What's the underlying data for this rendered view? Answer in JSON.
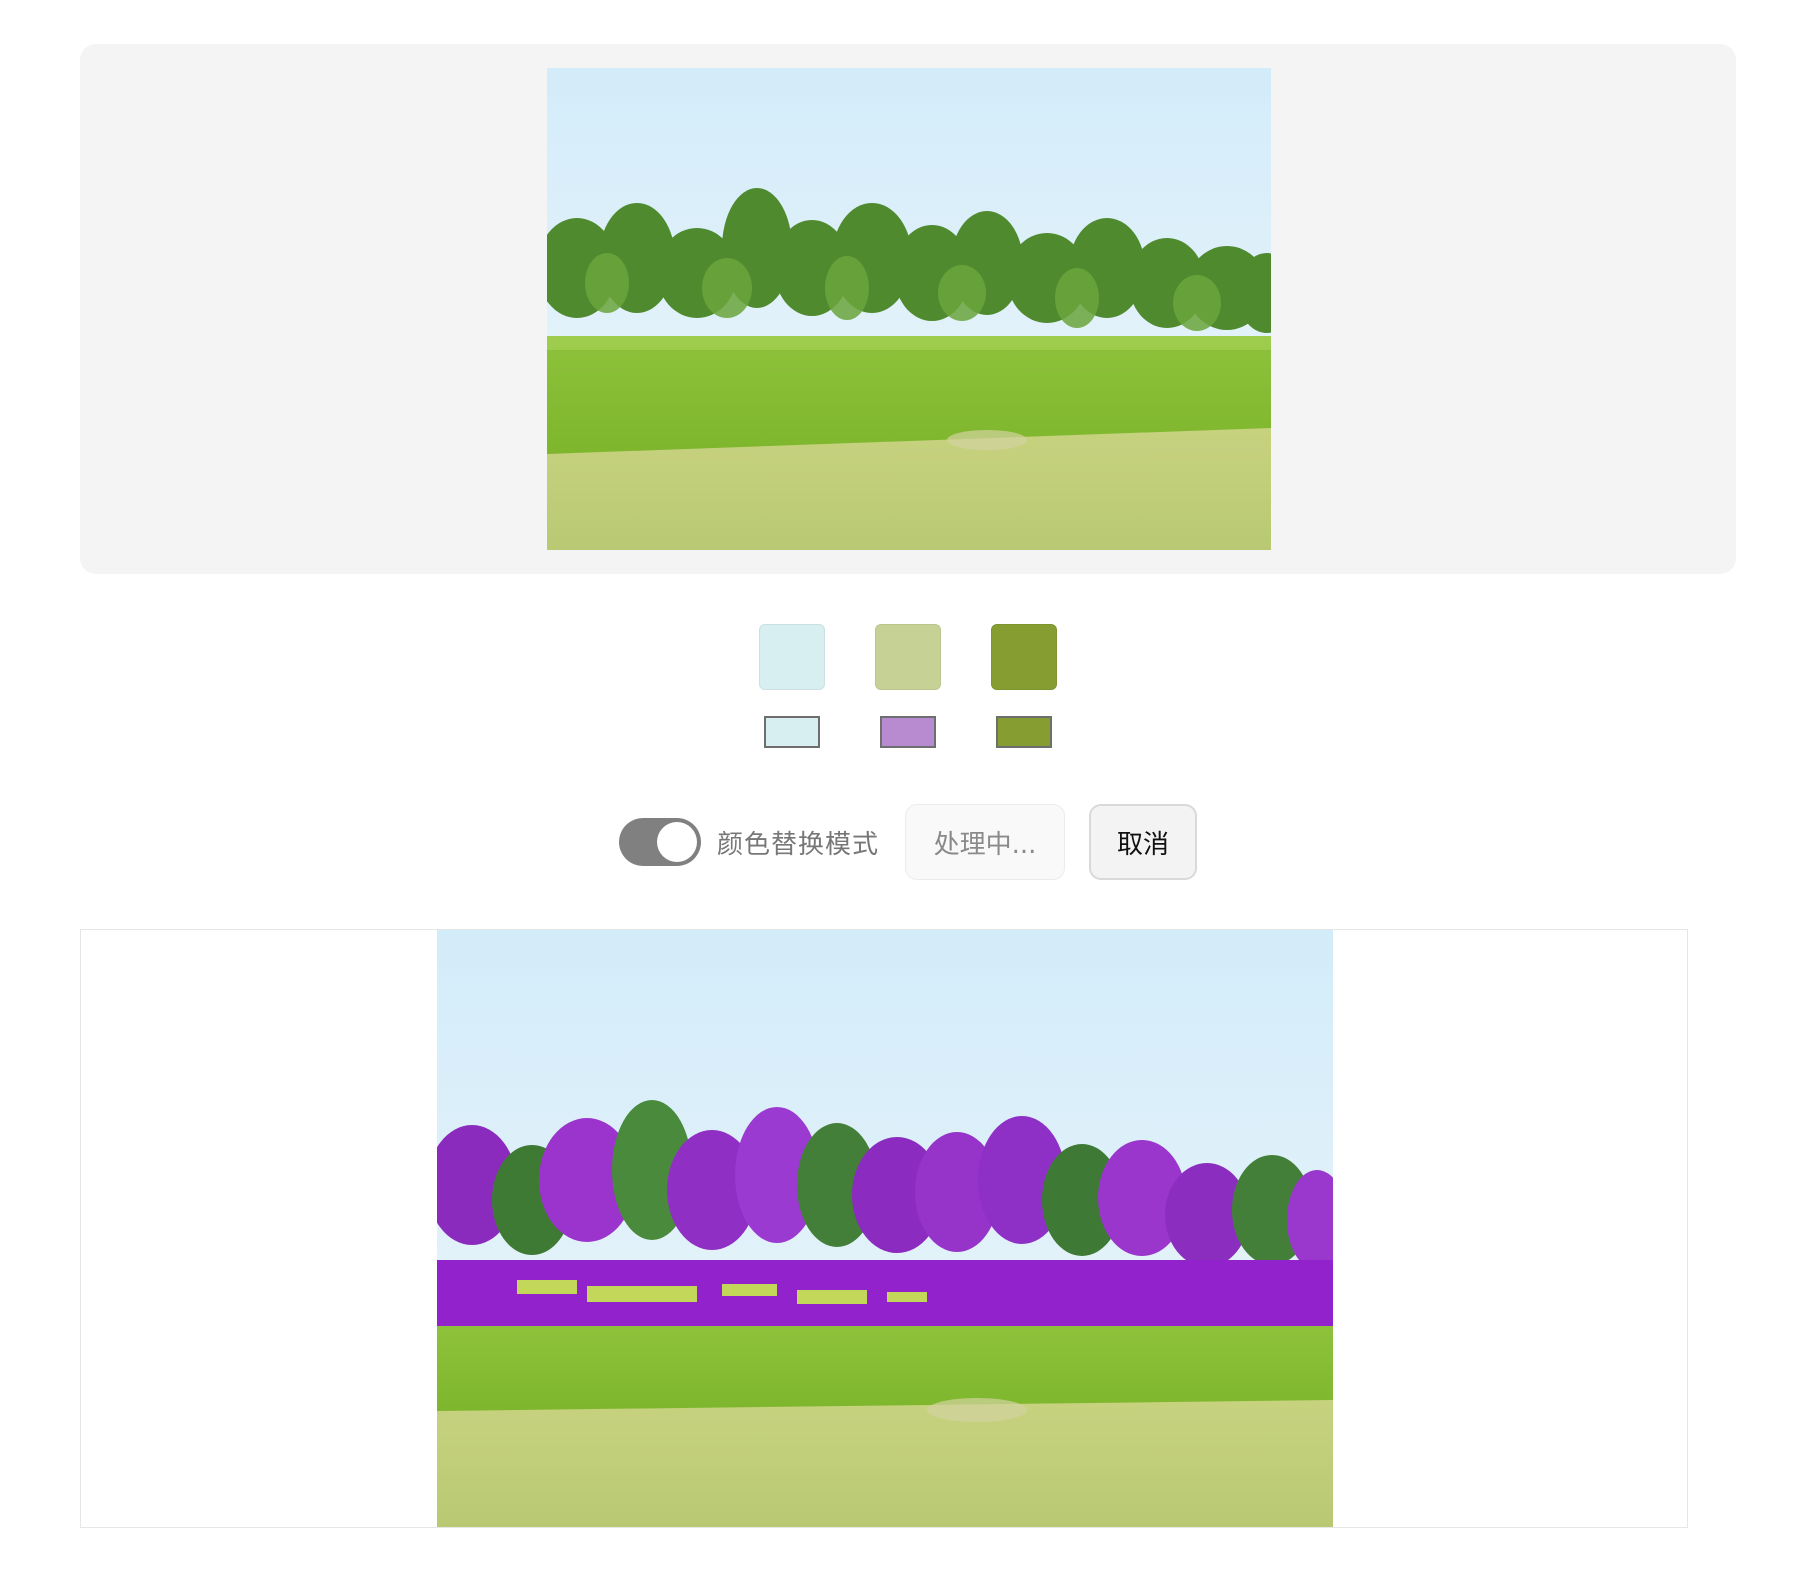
{
  "source_image": {
    "alt": "meadow landscape"
  },
  "palette": {
    "original_colors": [
      "#d7eff0",
      "#c6d196",
      "#869e31"
    ],
    "replacement_colors": [
      "#d7eff0",
      "#b88bd0",
      "#869e31"
    ]
  },
  "controls": {
    "mode_toggle_on": true,
    "mode_label": "颜色替换模式",
    "processing_label": "处理中...",
    "cancel_label": "取消"
  },
  "result_image": {
    "alt": "meadow landscape with replaced foliage color"
  }
}
